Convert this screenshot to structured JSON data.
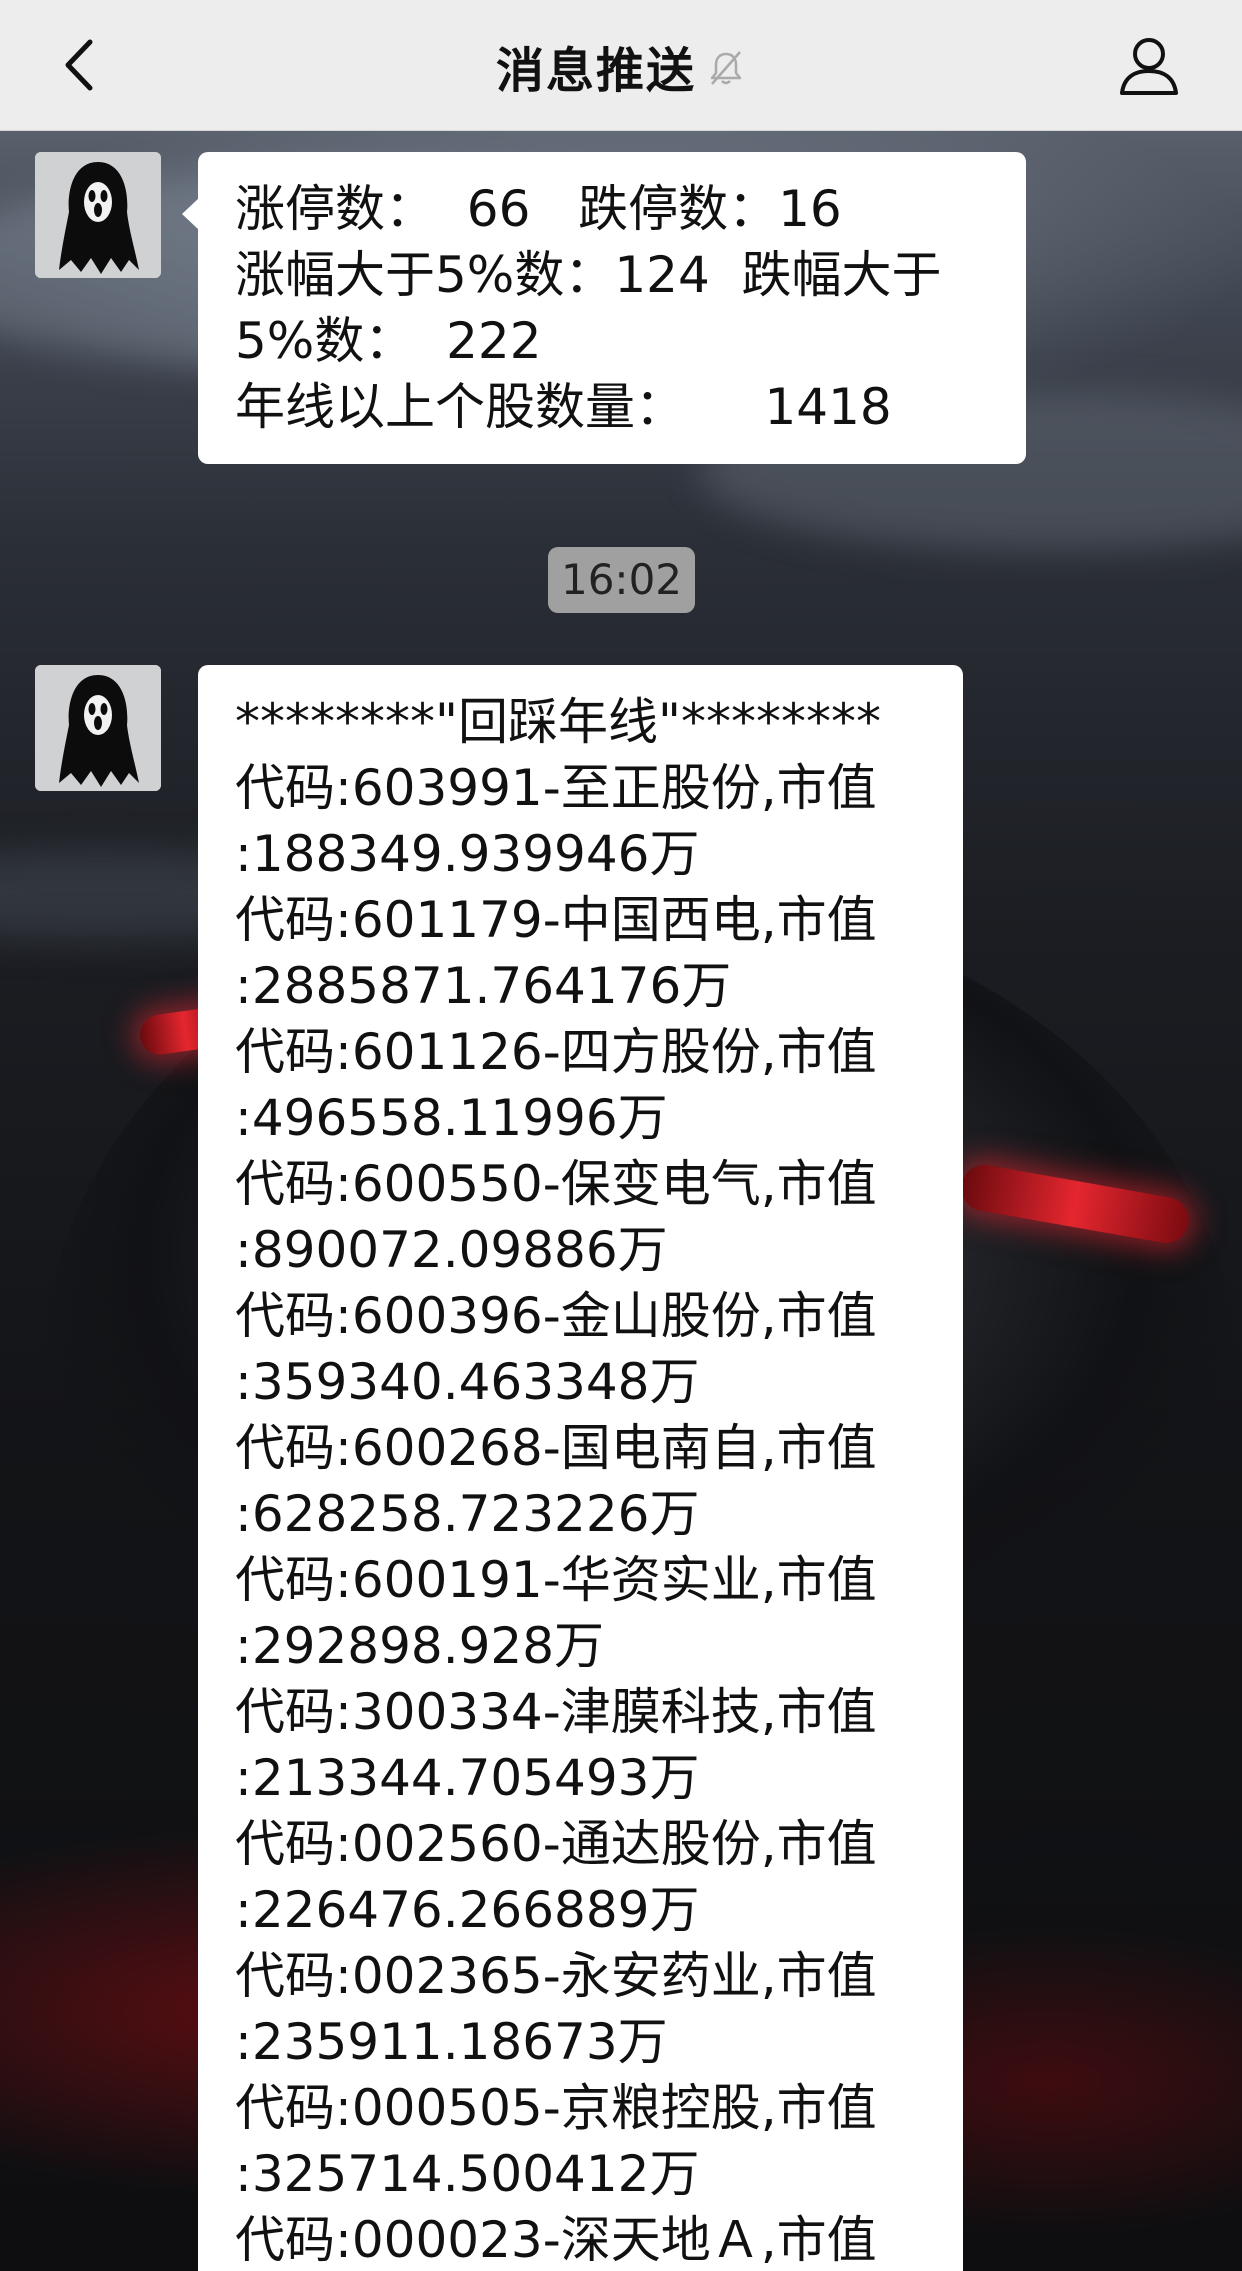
{
  "header": {
    "title": "消息推送"
  },
  "messages": [
    {
      "lines": [
        "涨停数：  66   跌停数：16",
        "涨幅大于5%数：124  跌幅大于",
        "5%数：  222",
        "年线以上个股数量：     1418"
      ]
    },
    {
      "lines": [
        "********\"回踩年线\"********",
        "代码:603991-至正股份,市值",
        ":188349.939946万",
        "代码:601179-中国西电,市值",
        ":2885871.764176万",
        "代码:601126-四方股份,市值",
        ":496558.11996万",
        "代码:600550-保变电气,市值",
        ":890072.09886万",
        "代码:600396-金山股份,市值",
        ":359340.463348万",
        "代码:600268-国电南自,市值",
        ":628258.723226万",
        "代码:600191-华资实业,市值",
        ":292898.928万",
        "代码:300334-津膜科技,市值",
        ":213344.705493万",
        "代码:002560-通达股份,市值",
        ":226476.266889万",
        "代码:002365-永安药业,市值",
        ":235911.18673万",
        "代码:000505-京粮控股,市值",
        ":325714.500412万",
        "代码:000023-深天地Ａ,市值"
      ]
    }
  ],
  "timestamp": "16:02",
  "icons": {
    "back": "chevron-left-icon",
    "mute": "bell-muted-icon",
    "profile": "person-icon",
    "avatar": "ghost-scream-avatar"
  }
}
